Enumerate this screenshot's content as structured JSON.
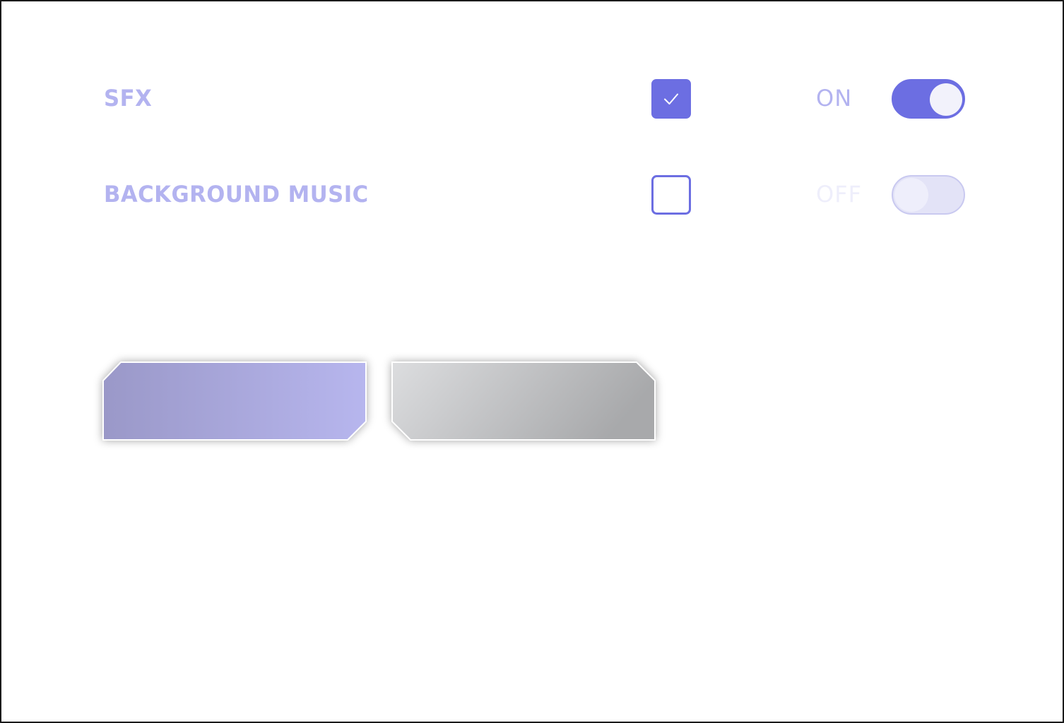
{
  "settings": {
    "sfx": {
      "label": "SFX",
      "checkbox_checked": true,
      "state_label": "ON",
      "toggle_on": true
    },
    "background_music": {
      "label": "BACKGROUND MUSIC",
      "checkbox_checked": false,
      "state_label": "OFF",
      "toggle_on": false
    }
  },
  "buttons": {
    "primary_label": "",
    "secondary_label": ""
  },
  "colors": {
    "accent": "#6c6ee2",
    "label": "#b3b3f0",
    "state_on": "#b3b3f0",
    "state_off": "#eeeefb",
    "toggle_off_track": "#e3e3f7",
    "toggle_off_border": "#c9c9f0",
    "knob_on": "#f2f2fb",
    "knob_off": "#eeeefb",
    "primary_gradient": [
      "#9a98c8",
      "#b7b6ee"
    ],
    "secondary_gradient": [
      "#dcdddf",
      "#a8a9ab"
    ]
  }
}
